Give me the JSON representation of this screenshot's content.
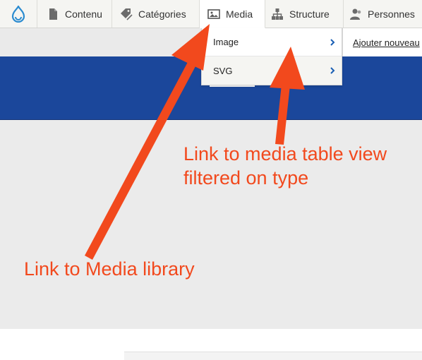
{
  "toolbar": {
    "logo_icon": "drupal-drop-icon",
    "items": [
      {
        "label": "Contenu",
        "icon": "page-icon"
      },
      {
        "label": "Catégories",
        "icon": "tag-icon"
      },
      {
        "label": "Media",
        "icon": "image-icon",
        "active": true
      },
      {
        "label": "Structure",
        "icon": "sitemap-icon"
      },
      {
        "label": "Personnes",
        "icon": "people-icon"
      }
    ]
  },
  "dropdown": {
    "items": [
      {
        "label": "Image"
      },
      {
        "label": "SVG"
      }
    ],
    "submenu_link": "Ajouter nouveau"
  },
  "annotations": {
    "table_view": "Link to media table view\nfiltered on type",
    "table_view_line1": "Link to media table view",
    "table_view_line2": "filtered on type",
    "library": "Link to Media library"
  },
  "colors": {
    "accent_blue": "#1b479b",
    "annotation": "#f2491d",
    "toolbar_bg": "#f5f5f2",
    "content_bg": "#ebebeb",
    "link_chevron": "#1a5fb4"
  }
}
